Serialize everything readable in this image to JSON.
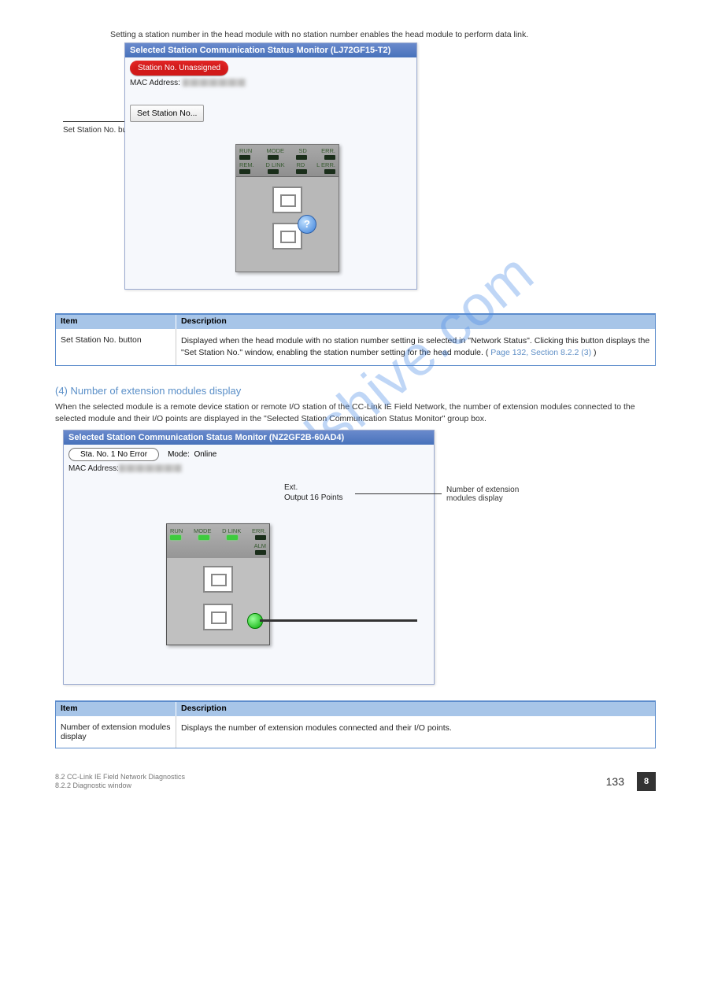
{
  "watermark": "manualshive.com",
  "intro_text": "Setting a station number in the head module with no station number enables the head module to perform data link.",
  "monitor1": {
    "title": "Selected Station Communication Status Monitor (LJ72GF15-T2)",
    "pill": "Station No. Unassigned",
    "mac_label": "MAC Address:",
    "set_btn": "Set Station No...",
    "led_row1": [
      "RUN",
      "MODE",
      "SD",
      "ERR."
    ],
    "led_row2": [
      "REM.",
      "D LINK",
      "RD",
      "L ERR."
    ],
    "callout": "Set Station No. button"
  },
  "table1": {
    "h1": "Item",
    "h2": "Description",
    "r1_c1": "Set Station No. button",
    "r1_c2a": "Displayed when the head module with no station number setting is selected in \"Network Status\". Clicking this button displays the \"Set Station No.\" window, enabling the station number setting for the head module. (",
    "r1_c2_link": "Page 132, Section 8.2.2 (3)",
    "r1_c2b": ")"
  },
  "section4": {
    "head": "(4)   Number of extension modules display",
    "para": "When the selected module is a remote device station or remote I/O station of the CC-Link IE Field Network, the number of extension modules connected to the selected module and their I/O points are displayed in the \"Selected Station Communication Status Monitor\" group box."
  },
  "monitor2": {
    "title": "Selected Station Communication Status Monitor (NZ2GF2B-60AD4)",
    "pill": "Sta. No. 1        No Error",
    "mode_label": "Mode:",
    "mode_val": "Online",
    "mac_label": "MAC Address:",
    "ext1": "Ext.",
    "ext2": "Output 16 Points",
    "led_top": [
      "RUN",
      "MODE",
      "D LINK",
      "ERR."
    ],
    "alm": "ALM",
    "callout": "Number of extension modules display"
  },
  "table2": {
    "h1": "Item",
    "h2": "Description",
    "r1_c1": "Number of extension modules display",
    "r1_c2": "Displays the number of extension modules connected and their I/O points."
  },
  "footer": {
    "chapter_num": "8",
    "chapter_title": "8.2 CC-Link IE Field Network Diagnostics",
    "section_title": "8.2.2 Diagnostic window",
    "page": "133"
  }
}
